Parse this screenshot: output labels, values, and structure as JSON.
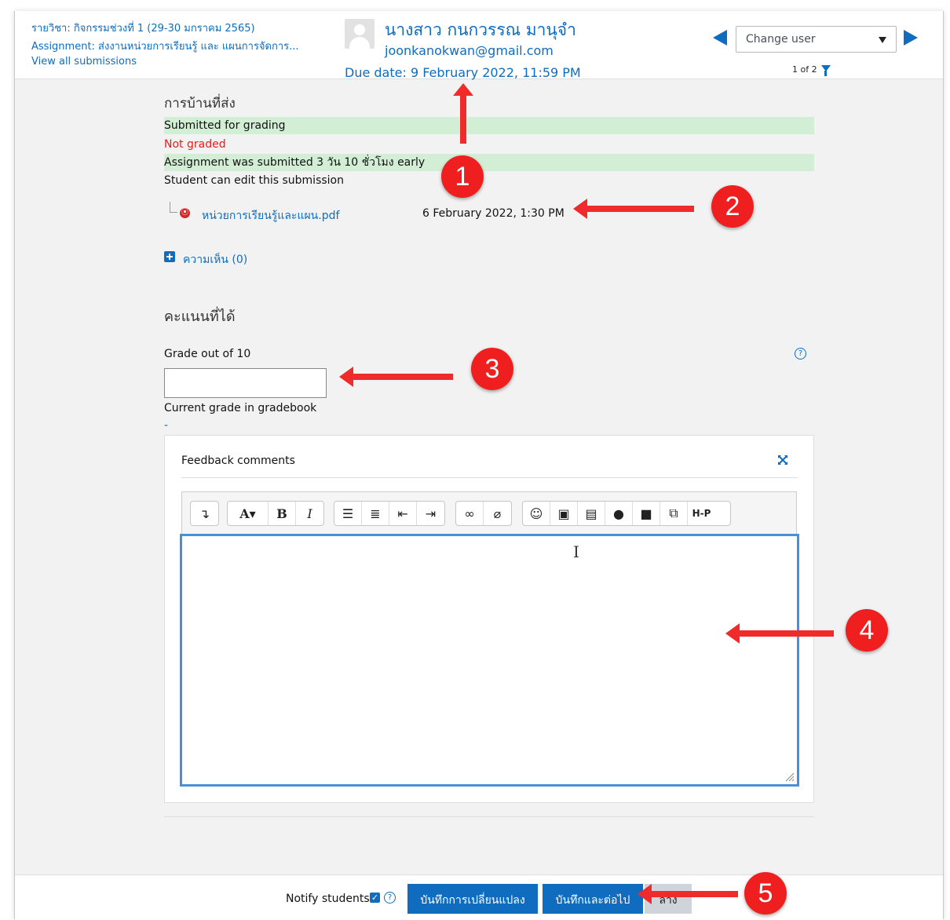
{
  "header": {
    "course": "รายวิชา: กิจกรรมช่วงที่ 1 (29-30 มกราคม 2565)",
    "assignment": "Assignment: ส่งงานหน่วยการเรียนรู้ และ แผนการจัดการ...",
    "view_all": "View all submissions",
    "user_name": "นางสาว กนกวรรณ มานุจำ",
    "user_email": "joonkanokwan@gmail.com",
    "due_date": "Due date: 9 February 2022, 11:59 PM",
    "change_user": "Change user",
    "pager": "1 of 2"
  },
  "submission": {
    "title": "การบ้านที่ส่ง",
    "status": "Submitted for grading",
    "grading": "Not graded",
    "timing": "Assignment was submitted 3 วัน 10 ชั่วโมง early",
    "editable": "Student can edit this submission",
    "file_name": "หน่วยการเรียนรู้และแผน.pdf",
    "file_date": "6 February 2022, 1:30 PM",
    "comments": "ความเห็น (0)"
  },
  "grade": {
    "title": "คะแนนที่ได้",
    "label": "Grade out of 10",
    "value": "",
    "current_label": "Current grade in gradebook",
    "current_value": "-"
  },
  "feedback": {
    "title": "Feedback comments",
    "toolbar_hp": "H-P"
  },
  "footer": {
    "notify": "Notify students",
    "save_label": "บันทึกการเปลี่ยนแปลง",
    "save_next_label": "บันทึกและต่อไป",
    "reset_label": "ล้าง"
  },
  "callouts": [
    "1",
    "2",
    "3",
    "4",
    "5"
  ],
  "colors": {
    "link": "#0f6cbf",
    "highlight": "#d2eed4",
    "not_graded": "#ea1a1a",
    "callout": "#ef1f1f"
  }
}
